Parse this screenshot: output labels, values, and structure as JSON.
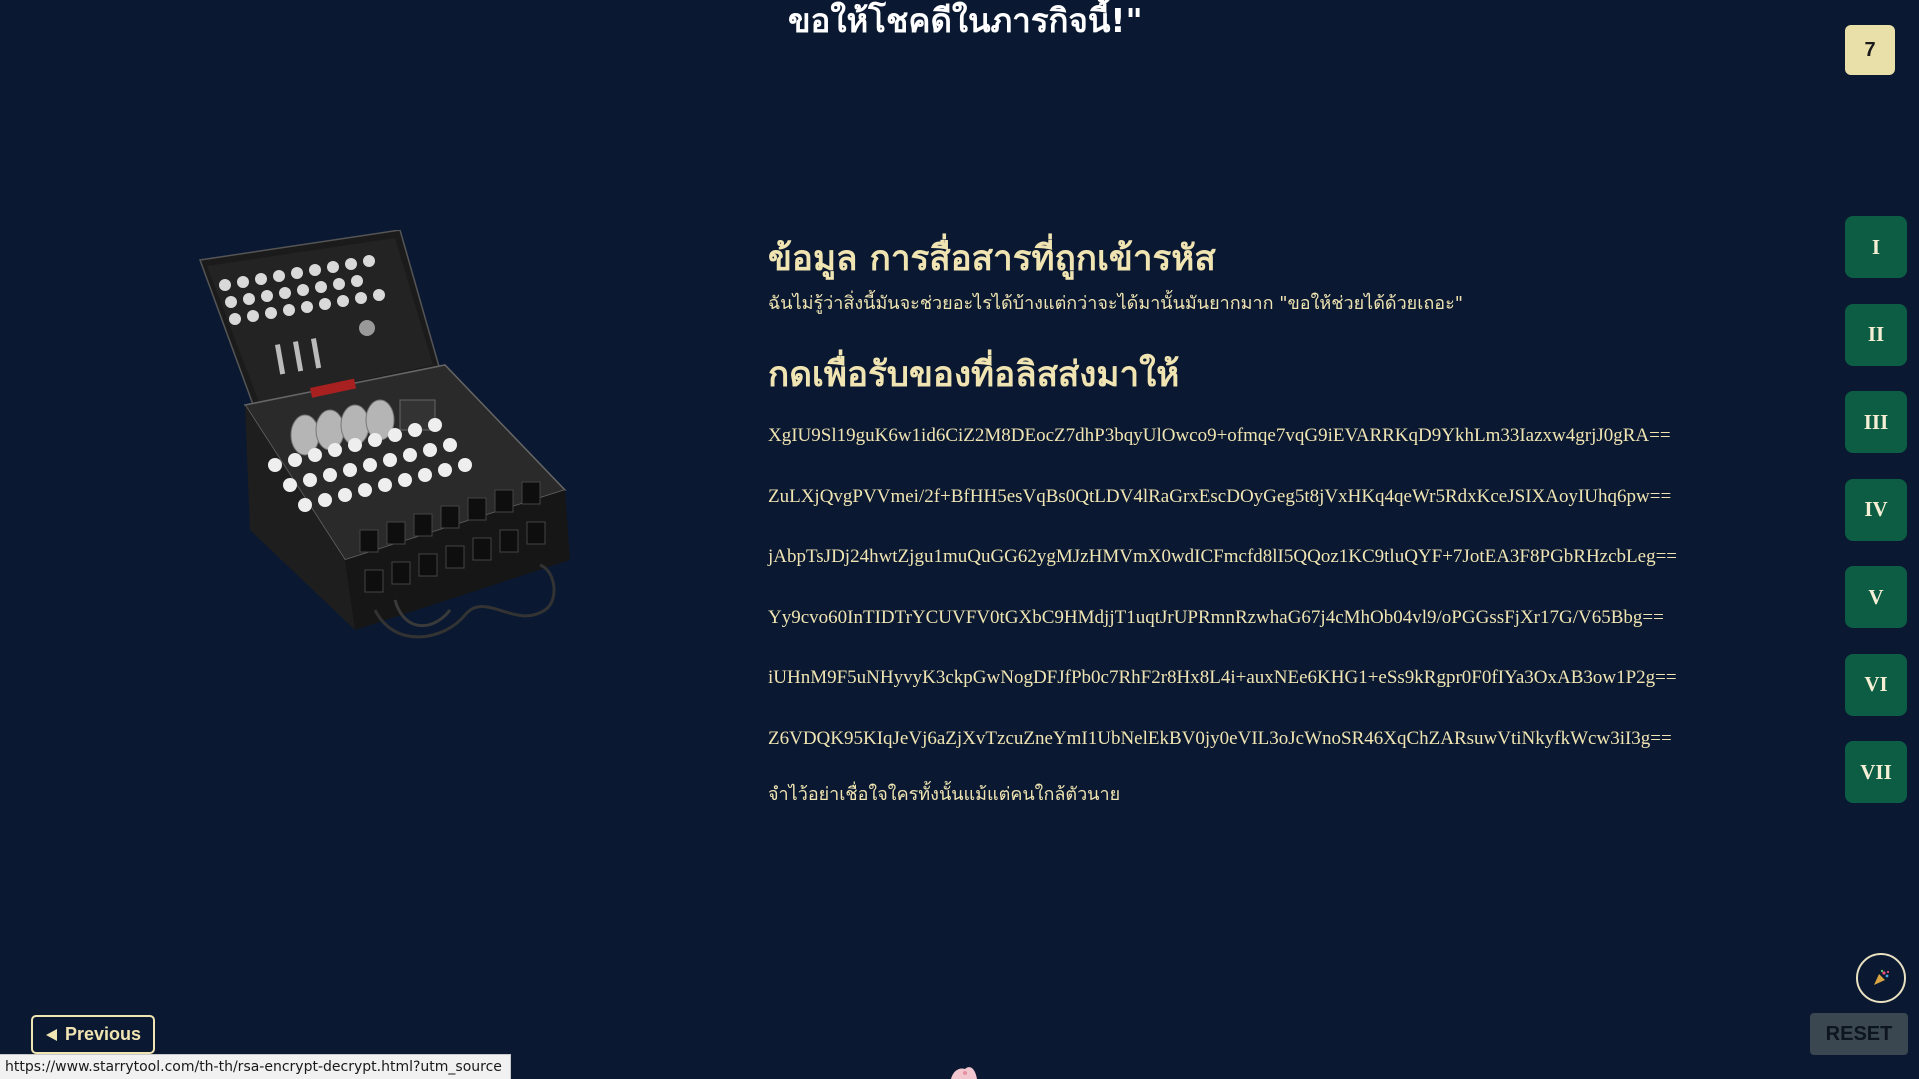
{
  "header": {
    "top_text": "ขอให้โชคดีในภารกิจนี้!\"",
    "counter": "7"
  },
  "image": {
    "icon": "enigma-machine-image"
  },
  "content": {
    "title1": "ข้อมูล การสื่อสารที่ถูกเข้ารหัส",
    "intro": "ฉันไม่รู้ว่าสิ่งนี้มันจะช่วยอะไรได้บ้างแต่กว่าจะได้มานั้นมันยากมาก \"ขอให้ช่วยได้ด้วยเถอะ\"",
    "title2": "กดเพื่อรับของที่อลิสส่งมาให้",
    "codes": [
      "XgIU9Sl19guK6w1id6CiZ2M8DEocZ7dhP3bqyUlOwco9+ofmqe7vqG9iEVARRKqD9YkhLm33Iazxw4grjJ0gRA==",
      "ZuLXjQvgPVVmei/2f+BfHH5esVqBs0QtLDV4lRaGrxEscDOyGeg5t8jVxHKq4qeWr5RdxKceJSIXAoyIUhq6pw==",
      "jAbpTsJDj24hwtZjgu1muQuGG62ygMJzHMVmX0wdICFmcfd8lI5QQoz1KC9tluQYF+7JotEA3F8PGbRHzcbLeg==",
      "Yy9cvo60InTIDTrYCUVFV0tGXbC9HMdjjT1uqtJrUPRmnRzwhaG67j4cMhOb04vl9/oPGGssFjXr17G/V65Bbg==",
      "iUHnM9F5uNHyvyK3ckpGwNogDFJfPb0c7RhF2r8Hx8L4i+auxNEe6KHG1+eSs9kRgpr0F0fIYa3OxAB3ow1P2g==",
      "Z6VDQK95KIqJeVj6aZjXvTzcuZneYmI1UbNelEkBV0jy0eVIL3oJcWnoSR46XqChZARsuwVtiNkyfkWcw3iI3g=="
    ],
    "outro": "จำไว้อย่าเชื่อใจใครทั้งนั้นแม้แต่คนใกล้ตัวนาย"
  },
  "nav": {
    "items": [
      "I",
      "II",
      "III",
      "IV",
      "V",
      "VI",
      "VII"
    ]
  },
  "controls": {
    "previous_label": "Previous",
    "previous_icon": "triangle-left-icon",
    "reset_label": "RESET",
    "party_icon": "party-popper-icon"
  },
  "status_bar": {
    "url": "https://www.starrytool.com/th-th/rsa-encrypt-decrypt.html?utm_source"
  },
  "colors": {
    "background": "#0a1931",
    "text": "#f0e4b2",
    "nav_button": "#0d5d45",
    "badge": "#e9dfa9",
    "reset_button": "#3a4650"
  }
}
